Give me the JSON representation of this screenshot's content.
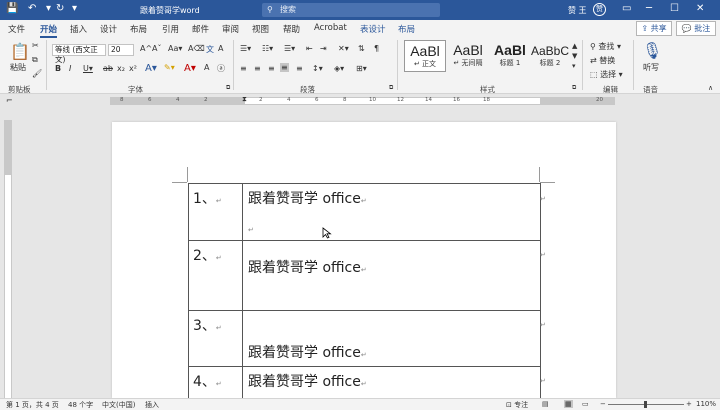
{
  "titlebar": {
    "doc_title": "跟着赞哥学word",
    "search_placeholder": "搜索",
    "user_name": "赞 王",
    "avatar_initial": "赞"
  },
  "tabs": [
    "文件",
    "开始",
    "插入",
    "设计",
    "布局",
    "引用",
    "邮件",
    "审阅",
    "视图",
    "帮助",
    "Acrobat",
    "表设计",
    "布局"
  ],
  "active_tab": "开始",
  "share_label": "共享",
  "comment_label": "批注",
  "ribbon": {
    "paste_label": "粘贴",
    "clipboard_group": "剪贴板",
    "font_name": "等线 (西文正文)",
    "font_size": "20",
    "font_group": "字体",
    "paragraph_group": "段落",
    "styles_group": "样式",
    "styles": [
      {
        "sample": "AaBl",
        "name": "↵ 正文"
      },
      {
        "sample": "AaBl",
        "name": "↵ 无间隔"
      },
      {
        "sample": "AaBl",
        "name": "标题 1"
      },
      {
        "sample": "AaBbC",
        "name": "标题 2"
      }
    ],
    "find_label": "查找",
    "replace_label": "替换",
    "select_label": "选择",
    "editing_group": "编辑",
    "dictate_label": "听写",
    "voice_group": "语音"
  },
  "ruler_ticks": [
    "8",
    "6",
    "4",
    "2",
    "2",
    "4",
    "6",
    "8",
    "10",
    "12",
    "14",
    "16",
    "18",
    "20"
  ],
  "table_rows": [
    {
      "num": "1、",
      "text": "跟着赞哥学 office"
    },
    {
      "num": "2、",
      "text": "跟着赞哥学 office"
    },
    {
      "num": "3、",
      "text": "跟着赞哥学 office"
    },
    {
      "num": "4、",
      "text": "跟着赞哥学 office"
    }
  ],
  "para_mark": "↵",
  "statusbar": {
    "page": "第 1 页，共 4 页",
    "words": "48 个字",
    "language": "中文(中国)",
    "mode": "插入",
    "focus": "专注",
    "zoom": "110%"
  }
}
